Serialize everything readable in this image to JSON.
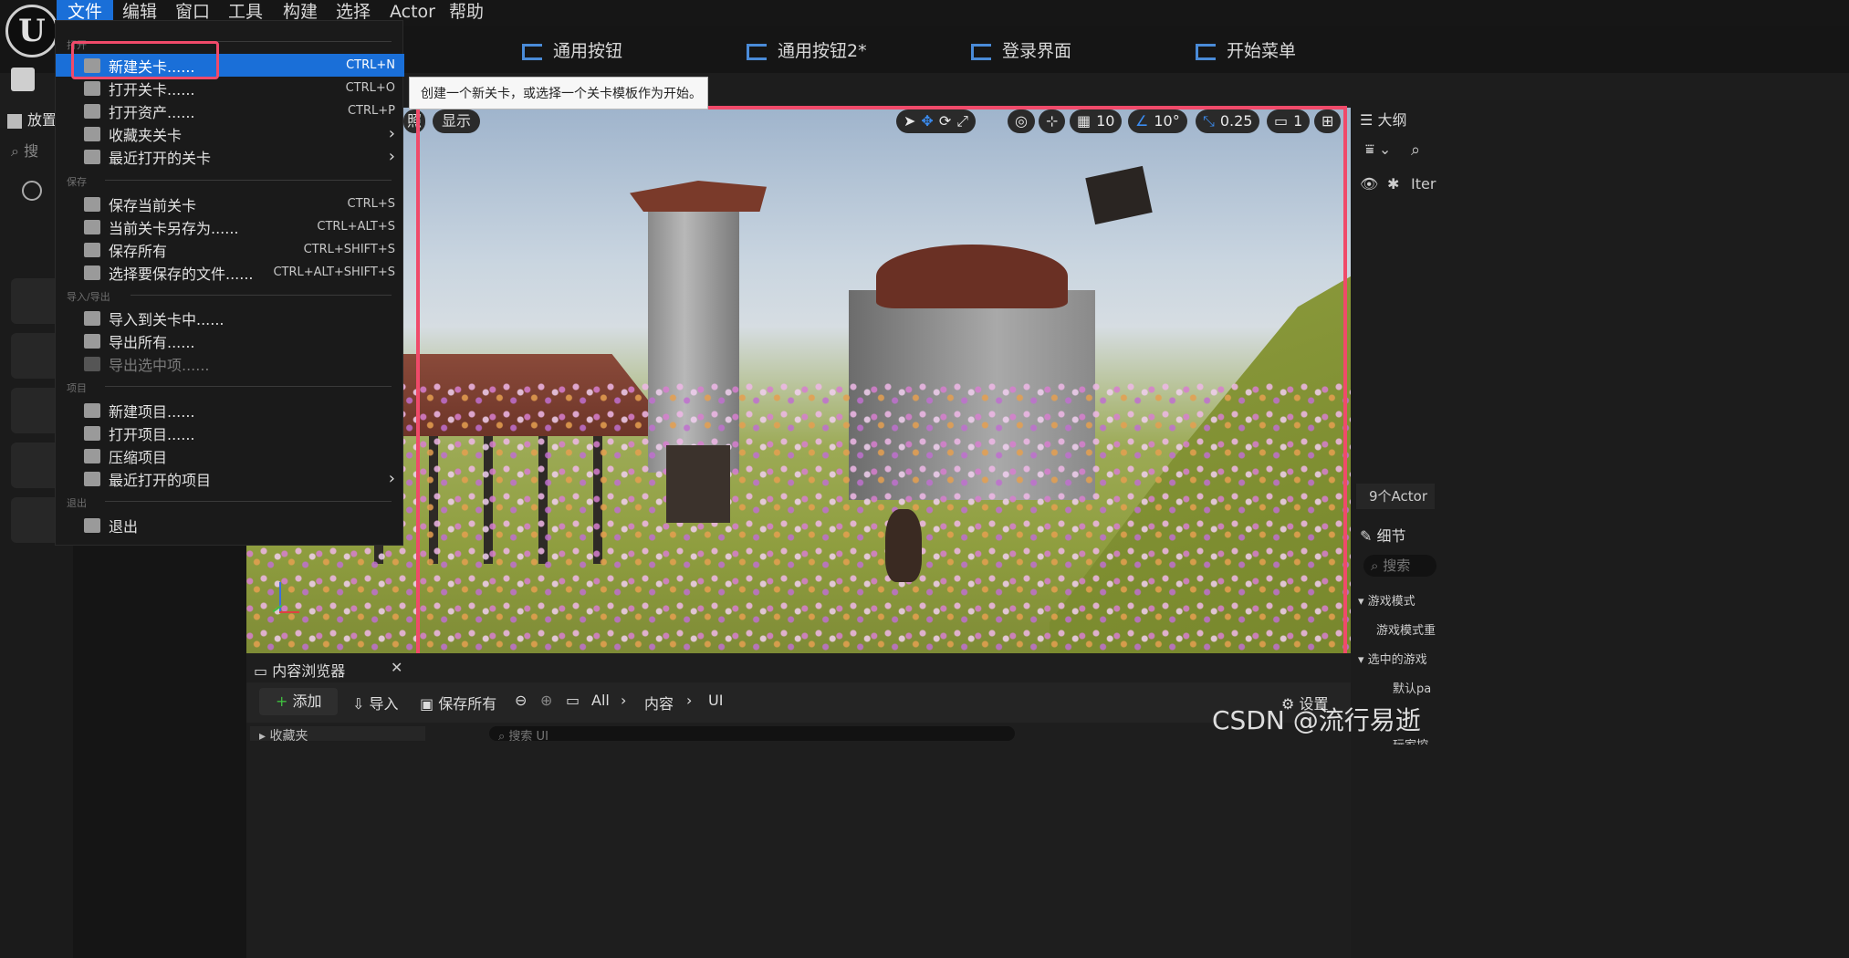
{
  "menubar": {
    "items": [
      "文件",
      "编辑",
      "窗口",
      "工具",
      "构建",
      "选择",
      "Actor",
      "帮助"
    ]
  },
  "tabs": [
    "通用按钮",
    "通用按钮2*",
    "登录界面",
    "开始菜单"
  ],
  "left_panel": {
    "place_label": "放置",
    "search_placeholder": "搜"
  },
  "file_menu": {
    "sections": {
      "open": "打开",
      "save": "保存",
      "import_export": "导入/导出",
      "project": "项目",
      "exit": "退出"
    },
    "items": [
      {
        "label": "新建关卡......",
        "shortcut": "CTRL+N"
      },
      {
        "label": "打开关卡......",
        "shortcut": "CTRL+O"
      },
      {
        "label": "打开资产......",
        "shortcut": "CTRL+P"
      },
      {
        "label": "收藏夹关卡",
        "shortcut": ""
      },
      {
        "label": "最近打开的关卡",
        "shortcut": ""
      },
      {
        "label": "保存当前关卡",
        "shortcut": "CTRL+S"
      },
      {
        "label": "当前关卡另存为......",
        "shortcut": "CTRL+ALT+S"
      },
      {
        "label": "保存所有",
        "shortcut": "CTRL+SHIFT+S"
      },
      {
        "label": "选择要保存的文件......",
        "shortcut": "CTRL+ALT+SHIFT+S"
      },
      {
        "label": "导入到关卡中......",
        "shortcut": ""
      },
      {
        "label": "导出所有......",
        "shortcut": ""
      },
      {
        "label": "导出选中项......",
        "shortcut": ""
      },
      {
        "label": "新建项目......",
        "shortcut": ""
      },
      {
        "label": "打开项目......",
        "shortcut": ""
      },
      {
        "label": "压缩项目",
        "shortcut": ""
      },
      {
        "label": "最近打开的项目",
        "shortcut": ""
      },
      {
        "label": "退出",
        "shortcut": ""
      }
    ]
  },
  "tooltip": "创建一个新关卡，或选择一个关卡模板作为开始。",
  "viewport": {
    "show_label": "显示",
    "perspective_label": "照",
    "grid_value": "10",
    "angle_value": "10°",
    "scale_value": "0.25",
    "camera_speed": "1"
  },
  "outliner": {
    "title": "大纲",
    "item_col": "Iter",
    "actor_count": "9个Actor"
  },
  "details": {
    "title": "细节",
    "search_placeholder": "搜索",
    "section1": "游戏模式",
    "row1": "游戏模式重",
    "section2": "选中的游戏",
    "row2": "默认pa",
    "row3": "玩家控"
  },
  "content_browser": {
    "title": "内容浏览器",
    "add_label": "添加",
    "import_label": "导入",
    "save_all_label": "保存所有",
    "path": [
      "All",
      "内容",
      "UI"
    ],
    "settings_label": "设置",
    "favorites_label": "收藏夹",
    "search_placeholder": "搜索 UI"
  },
  "watermark": "CSDN @流行易逝"
}
